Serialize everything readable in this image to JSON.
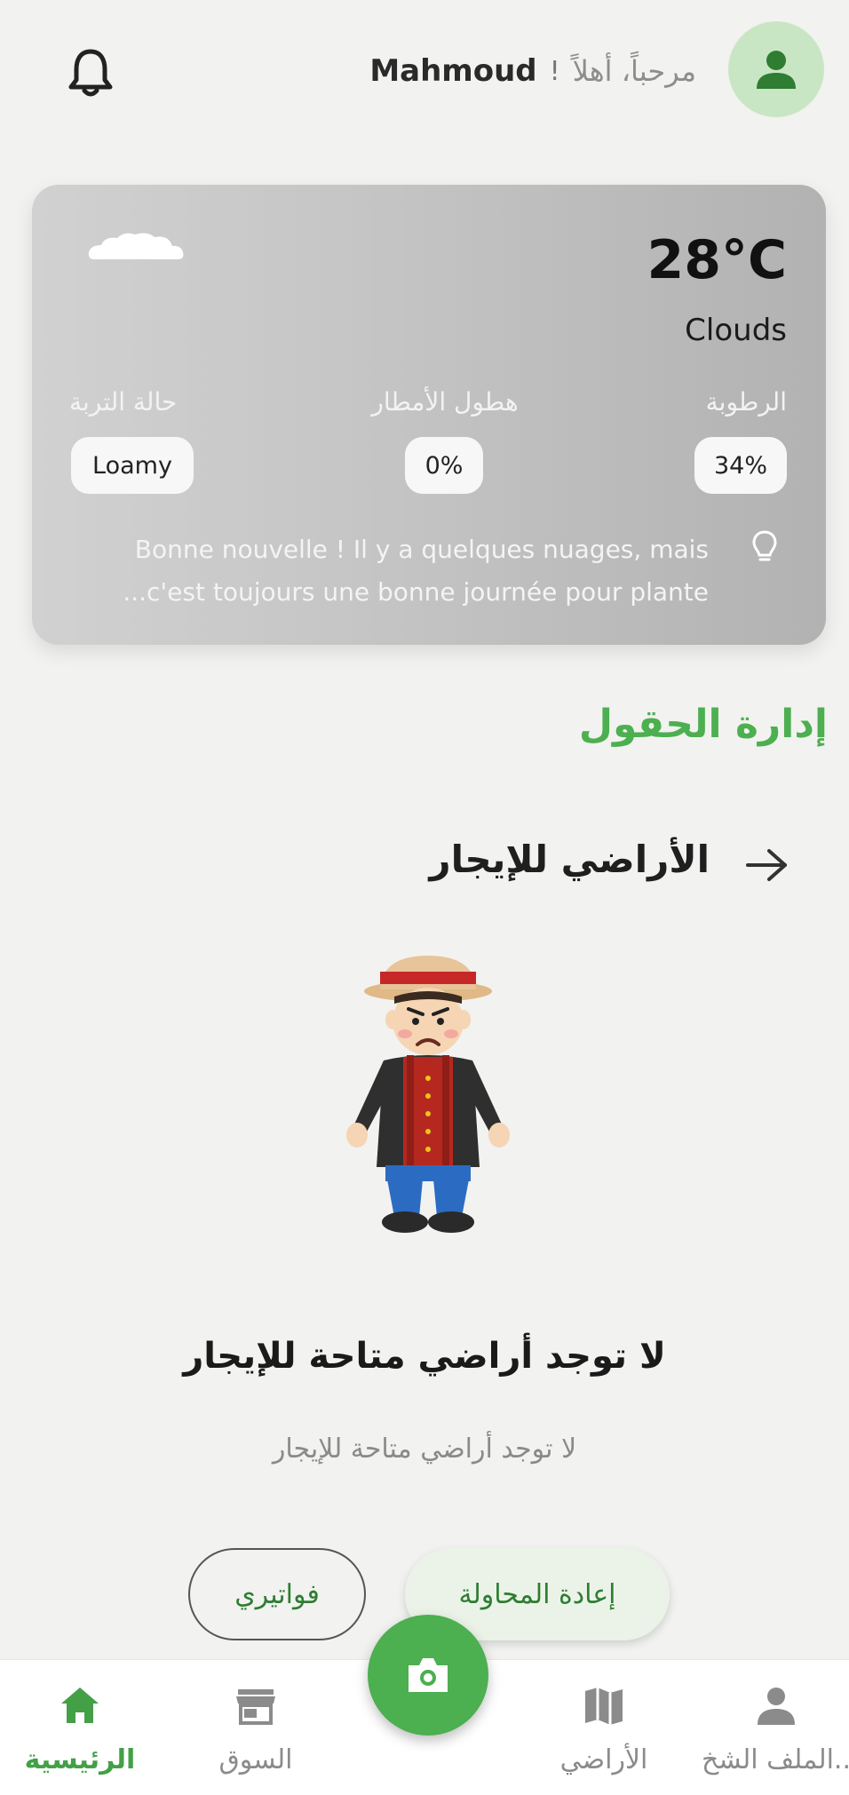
{
  "header": {
    "greeting": "مرحباً، أهلاً",
    "exclaim": "!",
    "username": "Mahmoud"
  },
  "weather": {
    "temperature": "28°C",
    "condition": "Clouds",
    "humidity_label": "الرطوبة",
    "humidity_value": "34%",
    "rain_label": "هطول الأمطار",
    "rain_value": "0%",
    "soil_label": "حالة التربة",
    "soil_value": "Loamy",
    "tip_line1": "Bonne nouvelle ! Il y a quelques nuages, mais",
    "tip_line2": "...c'est toujours une bonne journée pour plante"
  },
  "section": {
    "title": "إدارة الحقول",
    "rent_title": "الأراضي للإيجار"
  },
  "empty_state": {
    "title": "لا توجد أراضي متاحة للإيجار",
    "subtitle": "لا توجد أراضي متاحة للإيجار",
    "retry_label": "إعادة المحاولة",
    "bills_label": "فواتيري"
  },
  "nav": {
    "home": "الرئيسية",
    "market": "السوق",
    "lands": "الأراضي",
    "profile": "..الملف الشخ"
  },
  "colors": {
    "accent": "#4caf50",
    "avatar_bg": "#c9e6c4",
    "background": "#f2f2f0"
  }
}
